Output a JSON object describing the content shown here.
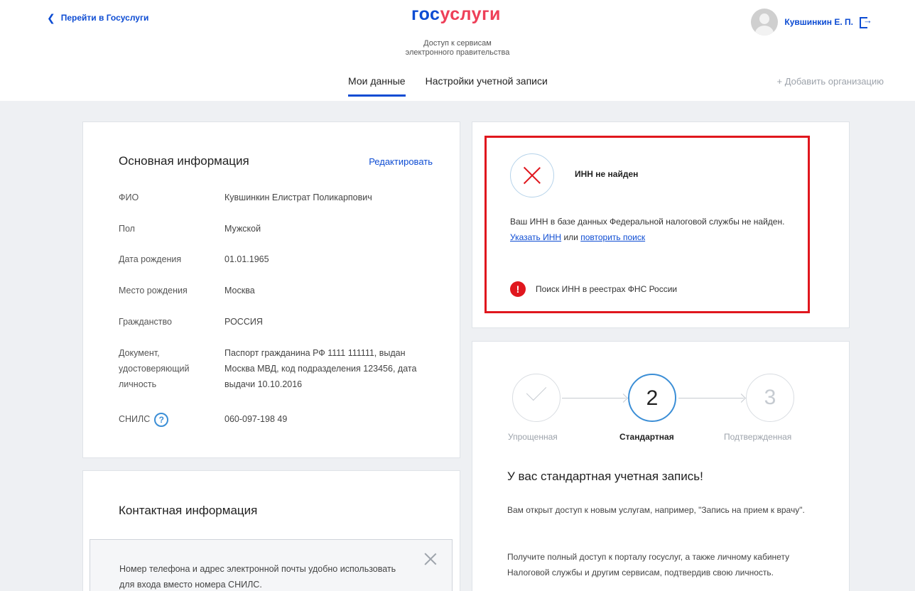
{
  "header": {
    "back_link": "Перейти в Госуслуги",
    "logo_part1": "гос",
    "logo_part2": "услуги",
    "subtitle_line1": "Доступ к сервисам",
    "subtitle_line2": "электронного правительства",
    "user_name": "Кувшинкин Е. П.",
    "tabs": [
      {
        "label": "Мои данные",
        "active": true
      },
      {
        "label": "Настройки учетной записи",
        "active": false
      }
    ],
    "add_org": "+ Добавить организацию"
  },
  "basic_info": {
    "title": "Основная информация",
    "edit_label": "Редактировать",
    "rows": [
      {
        "label": "ФИО",
        "value": "Кувшинкин Елистрат Поликарпович"
      },
      {
        "label": "Пол",
        "value": "Мужской"
      },
      {
        "label": "Дата рождения",
        "value": "01.01.1965"
      },
      {
        "label": "Место рождения",
        "value": "Москва"
      },
      {
        "label": "Гражданство",
        "value": "РОССИЯ"
      },
      {
        "label": "Документ, удостоверяющий личность",
        "value": "Паспорт гражданина РФ 1111 111111, выдан Москва МВД, код подразделения 123456, дата выдачи 10.10.2016"
      },
      {
        "label": "СНИЛС",
        "value": "060-097-198 49"
      }
    ],
    "help_glyph": "?"
  },
  "contact_info": {
    "title": "Контактная информация",
    "notice_text": "Номер телефона и адрес электронной почты удобно использовать для входа вместо номера СНИЛС."
  },
  "inn": {
    "title": "ИНН не найден",
    "text_before": "Ваш ИНН в базе данных Федеральной налоговой службы не найден.",
    "link1": "Указать ИНН",
    "text_mid": "или",
    "link2": "повторить поиск",
    "status_glyph": "!",
    "status_text": "Поиск ИНН в реестрах ФНС России",
    "alert_color": "#e0171e"
  },
  "account_level": {
    "steps": [
      {
        "number": "",
        "label": "Упрощенная",
        "state": "done"
      },
      {
        "number": "2",
        "label": "Стандартная",
        "state": "current"
      },
      {
        "number": "3",
        "label": "Подтвержденная",
        "state": "pending"
      }
    ],
    "title": "У вас стандартная учетная запись!",
    "text1": "Вам открыт доступ к новым услугам, например, \"Запись на прием к врачу\".",
    "text2": "Получите полный доступ к порталу госуслуг, а также личному кабинету Налоговой службы и другим сервисам, подтвердив свою личность."
  },
  "colors": {
    "accent": "#0d4cd3",
    "logo_red": "#ee3f58",
    "background": "#eef0f3"
  }
}
